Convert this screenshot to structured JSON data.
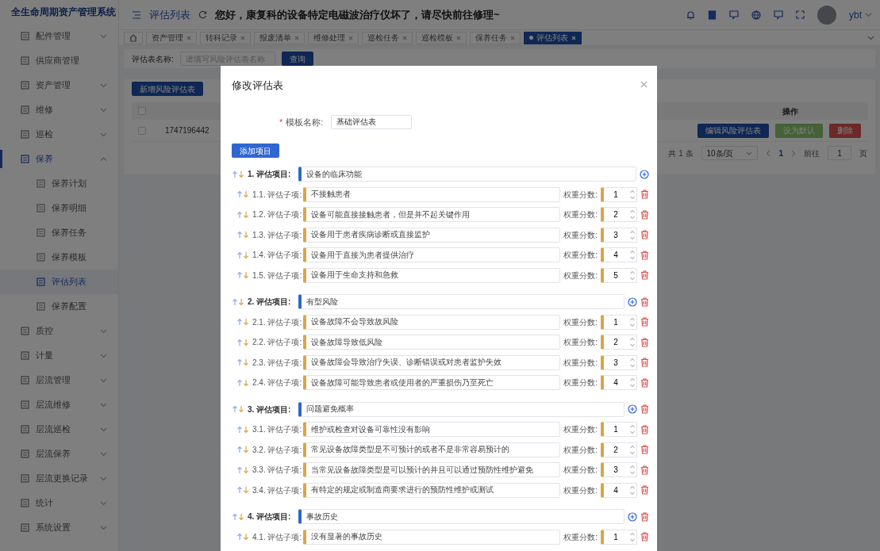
{
  "brand": {
    "title": "全生命周期资产管理系统"
  },
  "topbar": {
    "page_title": "评估列表",
    "notice": "您好，康复科的设备特定电磁波治疗仪坏了，请尽快前往修理~",
    "user": "ybt"
  },
  "sidebar": {
    "items": [
      {
        "label": "配件管理",
        "kind": "group",
        "expanded": false,
        "selected": false
      },
      {
        "label": "供应商管理",
        "kind": "link",
        "selected": false
      },
      {
        "label": "资产管理",
        "kind": "group",
        "expanded": false,
        "selected": false
      },
      {
        "label": "维修",
        "kind": "group",
        "expanded": false,
        "selected": false
      },
      {
        "label": "巡检",
        "kind": "group",
        "expanded": false,
        "selected": false
      },
      {
        "label": "保养",
        "kind": "group",
        "expanded": true,
        "selected": true,
        "children": [
          {
            "label": "保养计划",
            "selected": false
          },
          {
            "label": "保养明细",
            "selected": false
          },
          {
            "label": "保养任务",
            "selected": false
          },
          {
            "label": "保养模板",
            "selected": false
          },
          {
            "label": "评估列表",
            "selected": true
          },
          {
            "label": "保养配置",
            "selected": false
          }
        ]
      },
      {
        "label": "质控",
        "kind": "group",
        "expanded": false,
        "selected": false
      },
      {
        "label": "计量",
        "kind": "group",
        "expanded": false,
        "selected": false
      },
      {
        "label": "层流管理",
        "kind": "group",
        "expanded": false,
        "selected": false
      },
      {
        "label": "层流维修",
        "kind": "group",
        "expanded": false,
        "selected": false
      },
      {
        "label": "层流巡检",
        "kind": "group",
        "expanded": false,
        "selected": false
      },
      {
        "label": "层流保养",
        "kind": "group",
        "expanded": false,
        "selected": false
      },
      {
        "label": "层流更换记录",
        "kind": "group",
        "expanded": false,
        "selected": false
      },
      {
        "label": "统计",
        "kind": "group",
        "expanded": false,
        "selected": false
      },
      {
        "label": "系统设置",
        "kind": "group",
        "expanded": false,
        "selected": false
      }
    ]
  },
  "tabs": [
    {
      "label": "资产管理",
      "selected": false
    },
    {
      "label": "转科记录",
      "selected": false
    },
    {
      "label": "报废清单",
      "selected": false
    },
    {
      "label": "维修处理",
      "selected": false
    },
    {
      "label": "巡检任务",
      "selected": false
    },
    {
      "label": "巡检模板",
      "selected": false
    },
    {
      "label": "保养任务",
      "selected": false
    },
    {
      "label": "评估列表",
      "selected": true
    }
  ],
  "search": {
    "label": "评估表名称:",
    "placeholder": "请填写风险评估表名称",
    "button": "查询"
  },
  "add_button": "新增风险评估表",
  "table": {
    "all_checked": false,
    "action_header": "操作",
    "rows": [
      {
        "checked": false,
        "id": "1747196442",
        "actions": [
          {
            "label": "编辑风险评估表",
            "kind": "primary"
          },
          {
            "label": "设为默认",
            "kind": "success"
          },
          {
            "label": "删除",
            "kind": "danger"
          }
        ]
      }
    ]
  },
  "pagination": {
    "total": "共 1 条",
    "page_size": "10条/页",
    "pages": [
      {
        "label": "1",
        "selected": true
      }
    ],
    "goto_label": "前往",
    "goto_value": "1",
    "goto_suffix": "页"
  },
  "modal": {
    "title": "修改评估表",
    "template_label": "模板名称:",
    "required_mark": "*",
    "template_value": "基础评估表",
    "add_button": "添加项目",
    "items": [
      {
        "label": "1. 评估项目:",
        "value": "设备的临床功能",
        "deletable": false,
        "subitems": [
          {
            "label": "1.1. 评估子项:",
            "value": "不接触患者",
            "weight_label": "权重分数:",
            "weight": "1"
          },
          {
            "label": "1.2. 评估子项:",
            "value": "设备可能直接接触患者，但是并不起关键作用",
            "weight_label": "权重分数:",
            "weight": "2"
          },
          {
            "label": "1.3. 评估子项:",
            "value": "设备用于患者疾病诊断或直接监护",
            "weight_label": "权重分数:",
            "weight": "3"
          },
          {
            "label": "1.4. 评估子项:",
            "value": "设备用于直接为患者提供治疗",
            "weight_label": "权重分数:",
            "weight": "4"
          },
          {
            "label": "1.5. 评估子项:",
            "value": "设备用于生命支持和急救",
            "weight_label": "权重分数:",
            "weight": "5"
          }
        ]
      },
      {
        "label": "2. 评估项目:",
        "value": "有型风险",
        "deletable": true,
        "subitems": [
          {
            "label": "2.1. 评估子项:",
            "value": "设备故障不会导致故风险",
            "weight_label": "权重分数:",
            "weight": "1"
          },
          {
            "label": "2.2. 评估子项:",
            "value": "设备故障导致低风险",
            "weight_label": "权重分数:",
            "weight": "2"
          },
          {
            "label": "2.3. 评估子项:",
            "value": "设备故障会导致治疗失误、诊断错误或对患者监护失效",
            "weight_label": "权重分数:",
            "weight": "3"
          },
          {
            "label": "2.4. 评估子项:",
            "value": "设备故障可能导致患者或使用者的严重损伤乃至死亡",
            "weight_label": "权重分数:",
            "weight": "4"
          }
        ]
      },
      {
        "label": "3. 评估项目:",
        "value": "问题避免概率",
        "deletable": true,
        "subitems": [
          {
            "label": "3.1. 评估子项:",
            "value": "维护或检查对设备可靠性没有影响",
            "weight_label": "权重分数:",
            "weight": "1"
          },
          {
            "label": "3.2. 评估子项:",
            "value": "常见设备故障类型是不可预计的或者不是非常容易预计的",
            "weight_label": "权重分数:",
            "weight": "2"
          },
          {
            "label": "3.3. 评估子项:",
            "value": "当常见设备故障类型是可以预计的并且可以通过预防性维护避免",
            "weight_label": "权重分数:",
            "weight": "3"
          },
          {
            "label": "3.4. 评估子项:",
            "value": "有特定的规定或制造商要求进行的预防性维护或测试",
            "weight_label": "权重分数:",
            "weight": "4"
          }
        ]
      },
      {
        "label": "4. 评估项目:",
        "value": "事故历史",
        "deletable": true,
        "subitems": [
          {
            "label": "4.1. 评估子项:",
            "value": "没有显著的事故历史",
            "weight_label": "权重分数:",
            "weight": "1"
          }
        ]
      }
    ]
  }
}
